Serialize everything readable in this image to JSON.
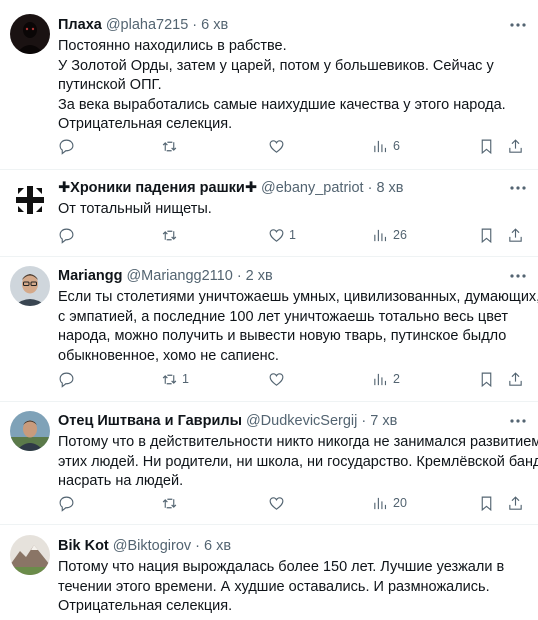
{
  "tweets": [
    {
      "name": "Плаха",
      "handle": "@plaha7215",
      "time": "6 хв",
      "lines": [
        "Постоянно находились в рабстве.",
        "У Золотой Орды, затем у царей, потом у большевиков. Сейчас у",
        "путинской ОПГ.",
        "За века выработались самые наихудшие качества у этого народа.",
        "Отрицательная селекция."
      ],
      "replies": "",
      "retweets": "",
      "likes": "",
      "views": "6",
      "avatar": "dark-silhouette-avatar"
    },
    {
      "name": "✚Хроники падения рашки✚",
      "handle": "@ebany_patriot",
      "time": "8 хв",
      "lines": [
        "От тотальный нищеты."
      ],
      "replies": "",
      "retweets": "",
      "likes": "1",
      "views": "26",
      "avatar": "black-white-cross-avatar"
    },
    {
      "name": "Mariangg",
      "handle": "@Mariangg2110",
      "time": "2 хв",
      "lines": [
        "Если ты столетиями уничтожаешь умных, цивилизованных, думающих,",
        "с эмпатией, а последние 100 лет уничтожаешь тотально весь цвет",
        "народа, можно получить и вывести новую тварь, путинское быдло",
        "обыкновенное, хомо не сапиенс."
      ],
      "replies": "",
      "retweets": "1",
      "likes": "",
      "views": "2",
      "avatar": "man-with-glasses-avatar"
    },
    {
      "name": "Отец Иштвана и Гаврилы",
      "handle": "@DudkevicSergij",
      "time": "7 хв",
      "lines": [
        "Потому что в действительности никто никогда не занимался развитием",
        "этих людей. Ни родители, ни школа, ни государство. Кремлёвской банде",
        "насрать на людей."
      ],
      "replies": "",
      "retweets": "",
      "likes": "",
      "views": "20",
      "avatar": "man-outdoors-avatar"
    },
    {
      "name": "Bik Kot",
      "handle": "@Biktogirov",
      "time": "6 хв",
      "lines": [
        "Потому что нация вырождалась более 150 лет. Лучшие уезжали в",
        "течении этого времени. А худшие оставались. И размножались.",
        "Отрицательная селекция."
      ],
      "replies": "",
      "retweets": "",
      "likes": "",
      "views": "",
      "avatar": "mountain-landscape-avatar"
    }
  ]
}
